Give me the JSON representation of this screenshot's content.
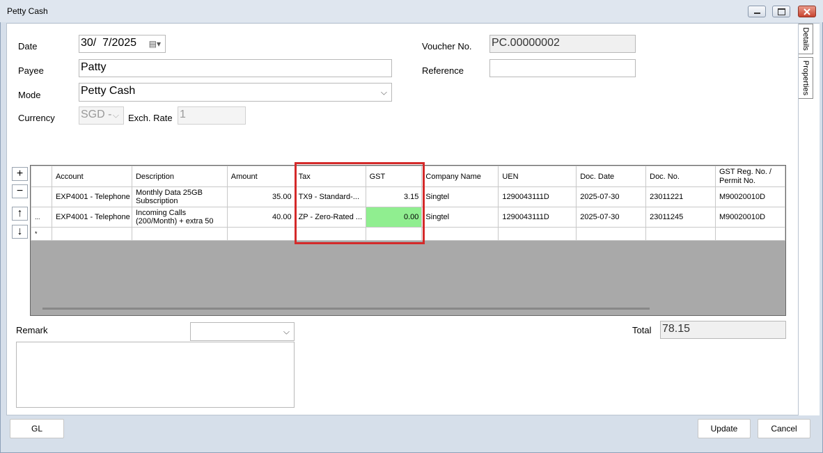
{
  "window": {
    "title": "Petty Cash"
  },
  "side_tabs": [
    "Details",
    "Properties"
  ],
  "form": {
    "date_label": "Date",
    "date_value": "30/  7/2025",
    "payee_label": "Payee",
    "payee_value": "Patty",
    "mode_label": "Mode",
    "mode_value": "Petty Cash",
    "currency_label": "Currency",
    "currency_value": "SGD -",
    "exch_rate_label": "Exch. Rate",
    "exch_rate_value": "1",
    "voucher_label": "Voucher No.",
    "voucher_value": "PC.00000002",
    "reference_label": "Reference",
    "reference_value": ""
  },
  "grid": {
    "columns": [
      "Account",
      "Description",
      "Amount",
      "Tax",
      "GST",
      "Company Name",
      "UEN",
      "Doc. Date",
      "Doc. No.",
      "GST Reg. No. / Permit No."
    ],
    "rows": [
      {
        "account": "EXP4001 - Telephone",
        "description": "Monthly Data 25GB Subscription",
        "amount": "35.00",
        "tax": "TX9 - Standard-...",
        "gst": "3.15",
        "company": "Singtel",
        "uen": "1290043111D",
        "doc_date": "2025-07-30",
        "doc_no": "23011221",
        "gst_reg": "M90020010D"
      },
      {
        "account": "EXP4001 - Telephone",
        "description": "Incoming Calls (200/Month) + extra 50",
        "amount": "40.00",
        "tax": "ZP - Zero-Rated ...",
        "gst": "0.00",
        "company": "Singtel",
        "uen": "1290043111D",
        "doc_date": "2025-07-30",
        "doc_no": "23011245",
        "gst_reg": "M90020010D"
      }
    ],
    "new_row_marker": "*",
    "edit_marker": "..."
  },
  "remark": {
    "label": "Remark",
    "value": ""
  },
  "total": {
    "label": "Total",
    "value": "78.15"
  },
  "buttons": {
    "gl": "GL",
    "update": "Update",
    "cancel": "Cancel"
  },
  "colors": {
    "highlight_cell": "#90ee90",
    "selection_border": "#d42a2a"
  }
}
